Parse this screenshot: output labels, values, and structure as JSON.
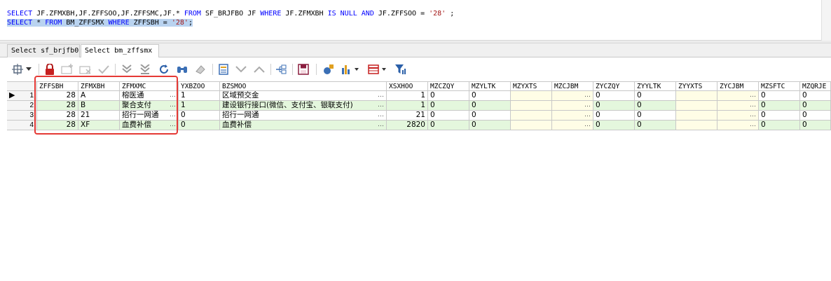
{
  "editor": {
    "line1": [
      {
        "t": "SELECT ",
        "c": "kw"
      },
      {
        "t": "JF.ZFMXBH,JF.ZFFSOO,JF.ZFFSMC,JF.* ",
        "c": "id"
      },
      {
        "t": "FROM ",
        "c": "kw"
      },
      {
        "t": "SF_BRJFBO JF ",
        "c": "id"
      },
      {
        "t": "WHERE ",
        "c": "kw"
      },
      {
        "t": "JF.ZFMXBH ",
        "c": "id"
      },
      {
        "t": "IS NULL AND ",
        "c": "kw"
      },
      {
        "t": "JF.ZFFSOO = ",
        "c": "id"
      },
      {
        "t": "'28'",
        "c": "str"
      },
      {
        "t": " ;",
        "c": "id"
      }
    ],
    "line2": [
      {
        "t": "SELECT ",
        "c": "kw"
      },
      {
        "t": "* ",
        "c": "id"
      },
      {
        "t": "FROM ",
        "c": "kw"
      },
      {
        "t": "BM_ZFFSMX ",
        "c": "id"
      },
      {
        "t": "WHERE ",
        "c": "kw"
      },
      {
        "t": "ZFFSBH = ",
        "c": "id"
      },
      {
        "t": "'28'",
        "c": "str"
      },
      {
        "t": ";",
        "c": "id"
      }
    ]
  },
  "tabs": [
    {
      "label": "Select sf_brjfb0",
      "active": false
    },
    {
      "label": "Select bm_zffsmx",
      "active": true
    }
  ],
  "toolbar": {
    "icons": [
      "pin-icon",
      "dropdown-arrow-icon",
      "lock-icon",
      "add-record-icon",
      "delete-record-icon",
      "post-check-icon",
      "fetch-next-page-icon",
      "fetch-all-icon",
      "refresh-icon",
      "find-icon",
      "clear-icon",
      "query-by-example-icon",
      "sort-down-icon",
      "sort-up-icon",
      "link-icon",
      "save-icon",
      "export-icon",
      "chart-icon",
      "single-record-icon",
      "filter-icon"
    ]
  },
  "grid": {
    "columns": [
      "ZFFSBH",
      "ZFMXBH",
      "ZFMXMC",
      "YXBZOO",
      "BZSMOO",
      "XSXHOO",
      "MZCZQY",
      "MZYLTK",
      "MZYXTS",
      "MZCJBM",
      "ZYCZQY",
      "ZYYLTK",
      "ZYYXTS",
      "ZYCJBM",
      "MZSFTC",
      "MZQRJE"
    ],
    "rows": [
      {
        "num": "1",
        "cells": [
          "28",
          "A",
          "榕医通",
          "1",
          "区域预交金",
          "1",
          "0",
          "0",
          "",
          "",
          "0",
          "0",
          "",
          "",
          "0",
          "0"
        ]
      },
      {
        "num": "2",
        "cells": [
          "28",
          "B",
          "聚合支付",
          "1",
          "建设银行接口(微信、支付宝、银联支付)",
          "1",
          "0",
          "0",
          "",
          "",
          "0",
          "0",
          "",
          "",
          "0",
          "0"
        ]
      },
      {
        "num": "3",
        "cells": [
          "28",
          "21",
          "招行一网通",
          "0",
          "招行一网通",
          "21",
          "0",
          "0",
          "",
          "",
          "0",
          "0",
          "",
          "",
          "0",
          "0"
        ]
      },
      {
        "num": "4",
        "cells": [
          "28",
          "XF",
          "血费补偿",
          "0",
          "血费补偿",
          "2820",
          "0",
          "0",
          "",
          "",
          "0",
          "0",
          "",
          "",
          "0",
          "0"
        ]
      }
    ],
    "current_row_marker": "▶",
    "ellipsis": "…"
  },
  "colors": {
    "keyword": "#0000ff",
    "string": "#a31515",
    "selection": "#b9d3f0",
    "alt_row": "#e4f7dd",
    "highlight_box": "#e53935"
  }
}
